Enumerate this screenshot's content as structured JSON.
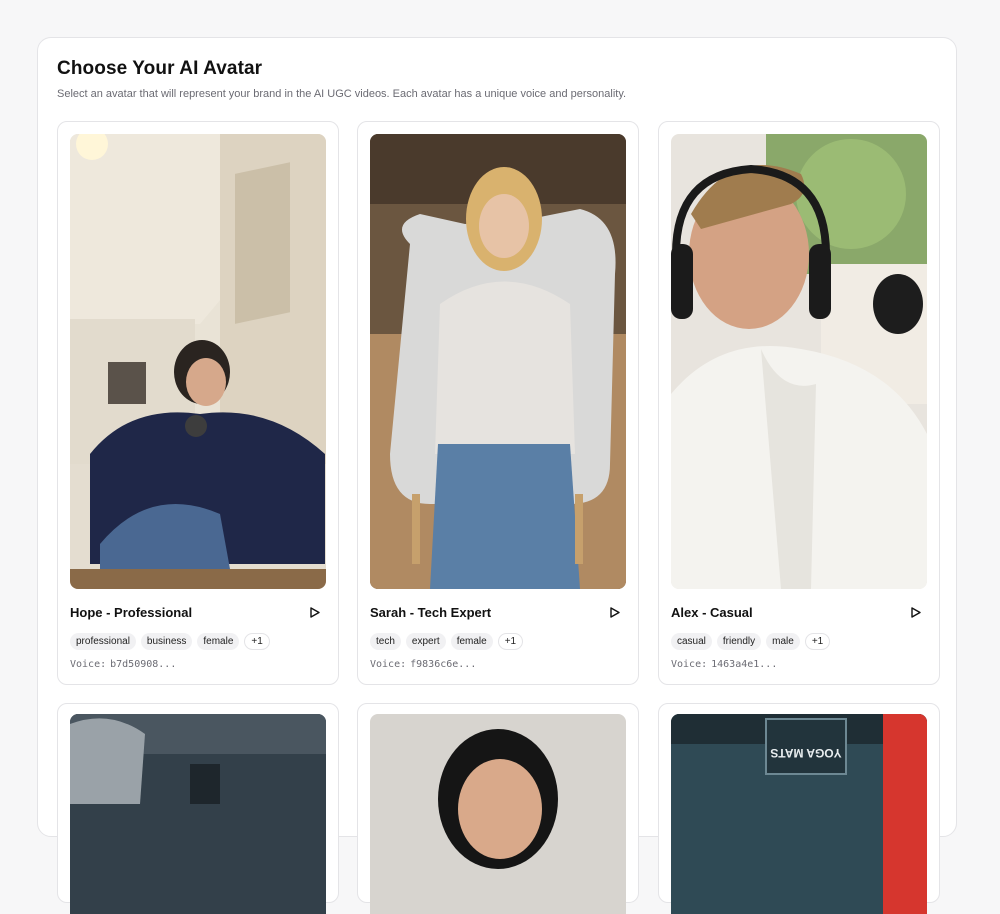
{
  "header": {
    "title": "Choose Your AI Avatar",
    "subtitle": "Select an avatar that will represent your brand in the AI UGC videos. Each avatar has a unique voice and personality."
  },
  "voice_label": "Voice:",
  "avatars": [
    {
      "name": "Hope - Professional",
      "tags": [
        "professional",
        "business",
        "female"
      ],
      "more": "+1",
      "voice": "b7d50908..."
    },
    {
      "name": "Sarah - Tech Expert",
      "tags": [
        "tech",
        "expert",
        "female"
      ],
      "more": "+1",
      "voice": "f9836c6e..."
    },
    {
      "name": "Alex - Casual",
      "tags": [
        "casual",
        "friendly",
        "male"
      ],
      "more": "+1",
      "voice": "1463a4e1..."
    }
  ],
  "partial_sign_text": "YOGA MATS",
  "colors": {
    "accent": "#111111",
    "border": "#e4e4e7",
    "tag_bg": "#f1f1f3"
  }
}
